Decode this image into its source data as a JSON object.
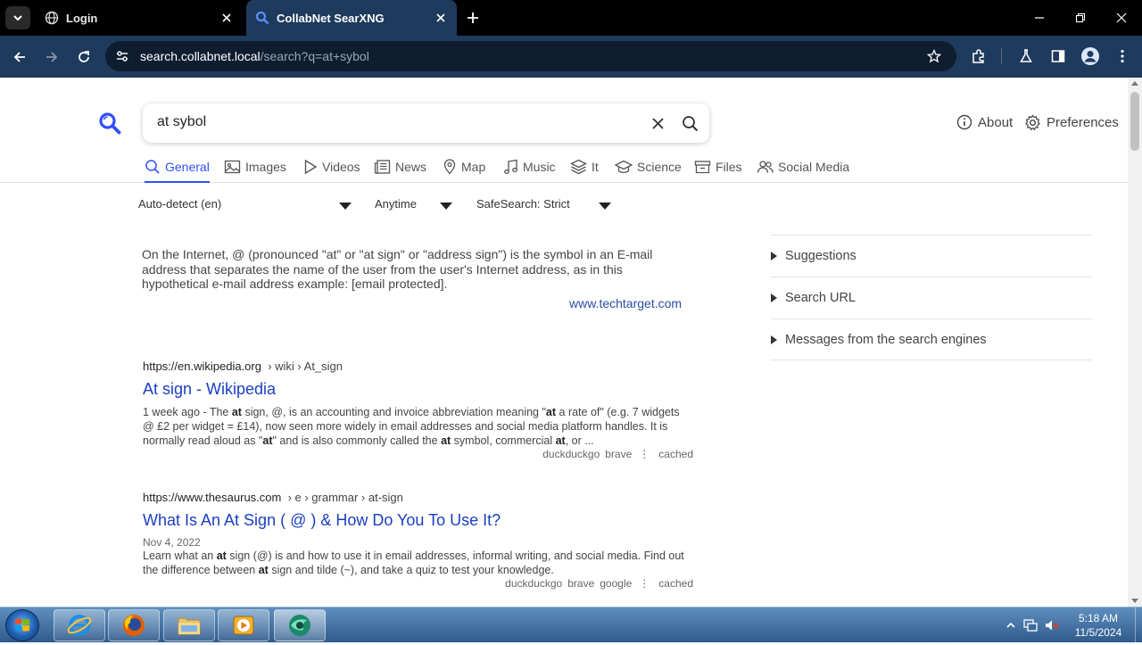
{
  "browser": {
    "tabs": [
      {
        "title": "Login",
        "active": false
      },
      {
        "title": "CollabNet SearXNG",
        "active": true
      }
    ],
    "url_host": "search.collabnet.local",
    "url_path": "/search?q=at+sybol"
  },
  "search": {
    "query": "at sybol",
    "about_label": "About",
    "preferences_label": "Preferences"
  },
  "categories": [
    {
      "label": "General",
      "icon": "search-icon",
      "active": true
    },
    {
      "label": "Images",
      "icon": "image-icon"
    },
    {
      "label": "Videos",
      "icon": "play-icon"
    },
    {
      "label": "News",
      "icon": "newspaper-icon"
    },
    {
      "label": "Map",
      "icon": "map-pin-icon"
    },
    {
      "label": "Music",
      "icon": "music-icon"
    },
    {
      "label": "It",
      "icon": "layers-icon"
    },
    {
      "label": "Science",
      "icon": "graduation-cap-icon"
    },
    {
      "label": "Files",
      "icon": "archive-icon"
    },
    {
      "label": "Social Media",
      "icon": "people-icon"
    }
  ],
  "filters": {
    "language": "Auto-detect (en)",
    "time": "Anytime",
    "safesearch": "SafeSearch: Strict"
  },
  "answer": {
    "text": "On the Internet, @ (pronounced \"at\" or \"at sign\" or \"address sign\") is the symbol in an E-mail address that separates the name of the user from the user's Internet address, as in this hypothetical e-mail address example: [email protected].",
    "source": "www.techtarget.com"
  },
  "results": [
    {
      "url": "https://en.wikipedia.org",
      "breadcrumbs": "› wiki › At_sign",
      "title": "At sign - Wikipedia",
      "date": "",
      "engines": [
        "duckduckgo",
        "brave"
      ],
      "cached_label": "cached"
    },
    {
      "url": "https://www.thesaurus.com",
      "breadcrumbs": "› e › grammar › at-sign",
      "title": "What Is An At Sign ( @ ) & How Do You To Use It?",
      "date": "Nov 4, 2022",
      "engines": [
        "duckduckgo",
        "brave",
        "google"
      ],
      "cached_label": "cached"
    }
  ],
  "sidebar": {
    "items": [
      "Suggestions",
      "Search URL",
      "Messages from the search engines"
    ]
  },
  "taskbar": {
    "time": "5:18 AM",
    "date": "11/5/2024"
  }
}
